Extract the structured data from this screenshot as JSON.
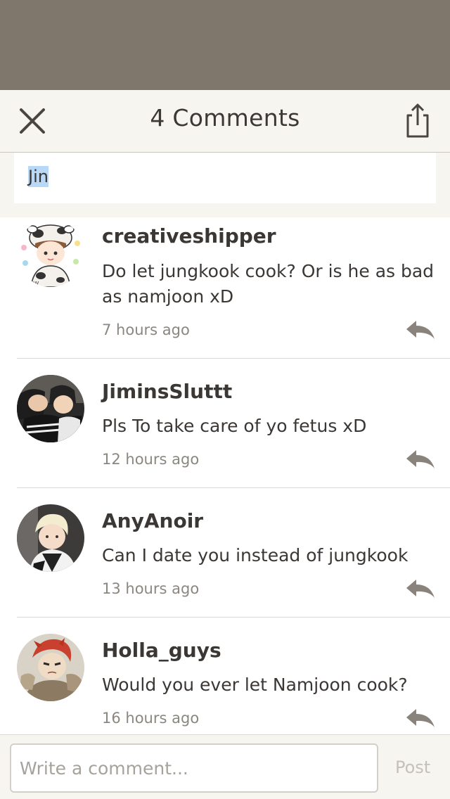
{
  "header": {
    "title": "4 Comments"
  },
  "quote": {
    "text": "Jin"
  },
  "comments": [
    {
      "username": "creativeshipper",
      "text": "Do let jungkook cook? Or is he as bad as namjoon xD",
      "time": "7 hours ago"
    },
    {
      "username": "JiminsSluttt",
      "text": "Pls To take care of yo fetus xD",
      "time": "12 hours ago"
    },
    {
      "username": "AnyAnoir",
      "text": "Can I date you instead of jungkook",
      "time": "13 hours ago"
    },
    {
      "username": "Holla_guys",
      "text": "Would you ever let Namjoon cook?",
      "time": "16 hours ago"
    }
  ],
  "footer": {
    "placeholder": "Write a comment...",
    "post_label": "Post"
  },
  "colors": {
    "backdrop": "#7f776c",
    "panel": "#f6f5f0",
    "highlight": "#b9d7f7",
    "icon": "#8a837b"
  }
}
